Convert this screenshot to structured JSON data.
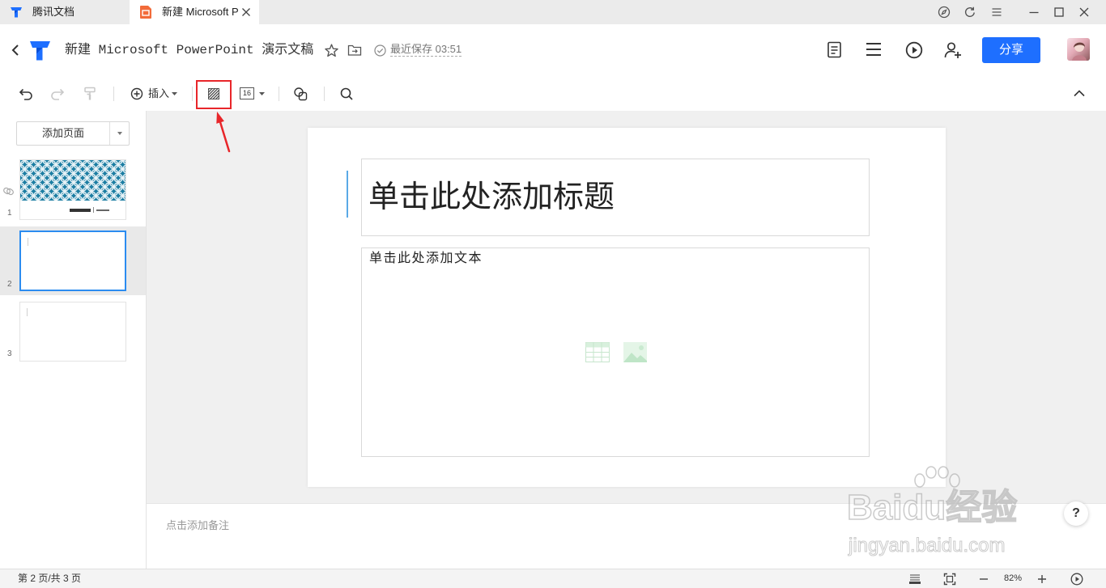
{
  "tabs": [
    {
      "label": "腾讯文档",
      "icon": "tencent-docs-logo-icon"
    },
    {
      "label": "新建 Microsoft P",
      "icon": "presentation-file-icon",
      "active": true
    }
  ],
  "window_controls": [
    "compass-icon",
    "refresh-icon",
    "menu-icon",
    "minimize-icon",
    "maximize-icon",
    "close-icon"
  ],
  "header": {
    "title": "新建 Microsoft PowerPoint 演示文稿",
    "save_status": "最近保存 03:51",
    "share_label": "分享",
    "actions": [
      "document-icon",
      "list-icon",
      "present-icon",
      "add-collaborator-icon"
    ]
  },
  "toolbar": {
    "insert_label": "插入",
    "font_size_label": "16",
    "highlighted_tool": "background-fill-icon"
  },
  "sidebar": {
    "add_page_label": "添加页面",
    "slides": [
      {
        "number": "1"
      },
      {
        "number": "2",
        "selected": true
      },
      {
        "number": "3"
      }
    ]
  },
  "slide": {
    "title_placeholder": "单击此处添加标题",
    "body_placeholder": "单击此处添加文本",
    "content_icons": [
      "insert-table-icon",
      "insert-image-icon"
    ]
  },
  "notes": {
    "placeholder": "点击添加备注"
  },
  "help": {
    "label": "?"
  },
  "status_bar": {
    "page_info": "第 2 页/共 3 页",
    "zoom": "82%"
  },
  "watermark": {
    "brand": "Baidu经验",
    "url": "jingyan.baidu.com"
  },
  "colors": {
    "accent": "#1e6fff",
    "annotation": "#e8262a",
    "selection_border": "#2b8cf0",
    "theme_teal": "#1d7ea3",
    "text_cursor": "#5aa9e6"
  }
}
